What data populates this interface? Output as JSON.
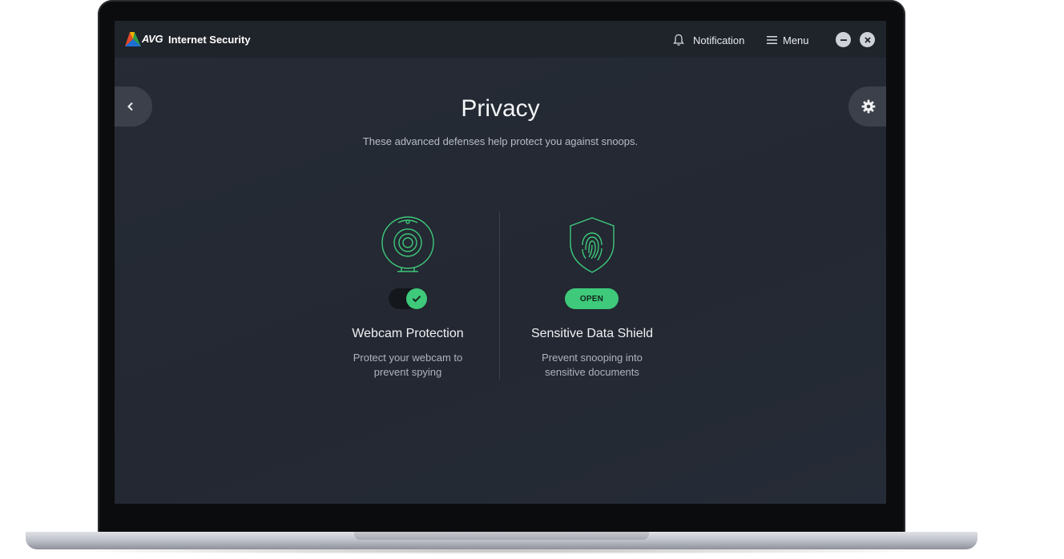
{
  "app": {
    "brand": "AVG",
    "product": "Internet Security"
  },
  "titlebar": {
    "notification_label": "Notification",
    "menu_label": "Menu"
  },
  "page": {
    "title": "Privacy",
    "subtitle": "These advanced defenses help protect you against snoops."
  },
  "features": [
    {
      "title": "Webcam Protection",
      "desc_line1": "Protect your webcam to",
      "desc_line2": "prevent spying",
      "control": "toggle",
      "enabled": true
    },
    {
      "title": "Sensitive Data Shield",
      "desc_line1": "Prevent snooping into",
      "desc_line2": "sensitive documents",
      "control": "button",
      "button_label": "OPEN"
    }
  ],
  "icons": {
    "logo": "avg-logo-icon",
    "notification": "bell-icon",
    "menu": "hamburger-icon",
    "minimize": "minimize-icon",
    "close": "close-icon",
    "back": "chevron-left-icon",
    "settings": "gear-icon",
    "webcam": "webcam-icon",
    "shield": "fingerprint-shield-icon",
    "check": "check-icon"
  },
  "colors": {
    "accent_green": "#3ec97b",
    "background": "#262b35",
    "titlebar": "#1f232a"
  }
}
